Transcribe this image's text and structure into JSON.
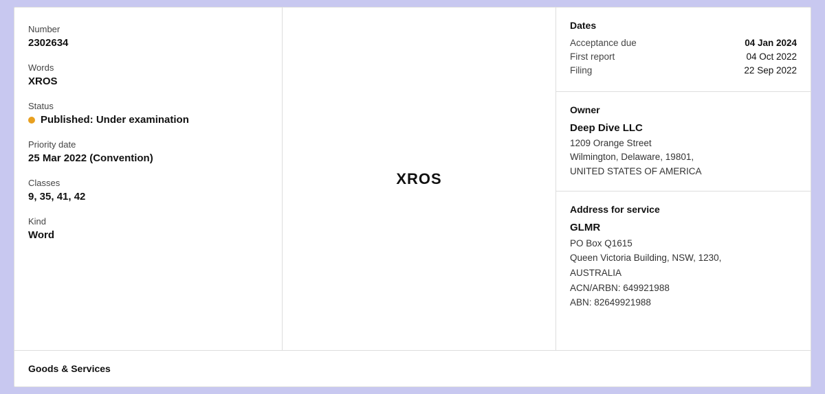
{
  "left": {
    "number_label": "Number",
    "number_value": "2302634",
    "words_label": "Words",
    "words_value": "XROS",
    "status_label": "Status",
    "status_value": "Published: Under examination",
    "priority_label": "Priority date",
    "priority_value": "25 Mar 2022 (Convention)",
    "classes_label": "Classes",
    "classes_value": "9, 35, 41, 42",
    "kind_label": "Kind",
    "kind_value": "Word"
  },
  "center": {
    "trademark": "XROS"
  },
  "right": {
    "dates_title": "Dates",
    "acceptance_label": "Acceptance due",
    "acceptance_value": "04 Jan 2024",
    "first_report_label": "First report",
    "first_report_value": "04 Oct 2022",
    "filing_label": "Filing",
    "filing_value": "22 Sep 2022",
    "owner_title": "Owner",
    "owner_name": "Deep Dive LLC",
    "owner_address_line1": "1209 Orange Street",
    "owner_address_line2": "Wilmington, Delaware, 19801,",
    "owner_address_line3": "UNITED STATES OF AMERICA",
    "service_title": "Address for service",
    "service_name": "GLMR",
    "service_line1": "PO Box Q1615",
    "service_line2": "Queen Victoria Building, NSW, 1230,",
    "service_line3": "AUSTRALIA",
    "service_line4": "ACN/ARBN: 649921988",
    "service_line5": "ABN: 82649921988"
  },
  "bottom": {
    "goods_label": "Goods & Services"
  }
}
